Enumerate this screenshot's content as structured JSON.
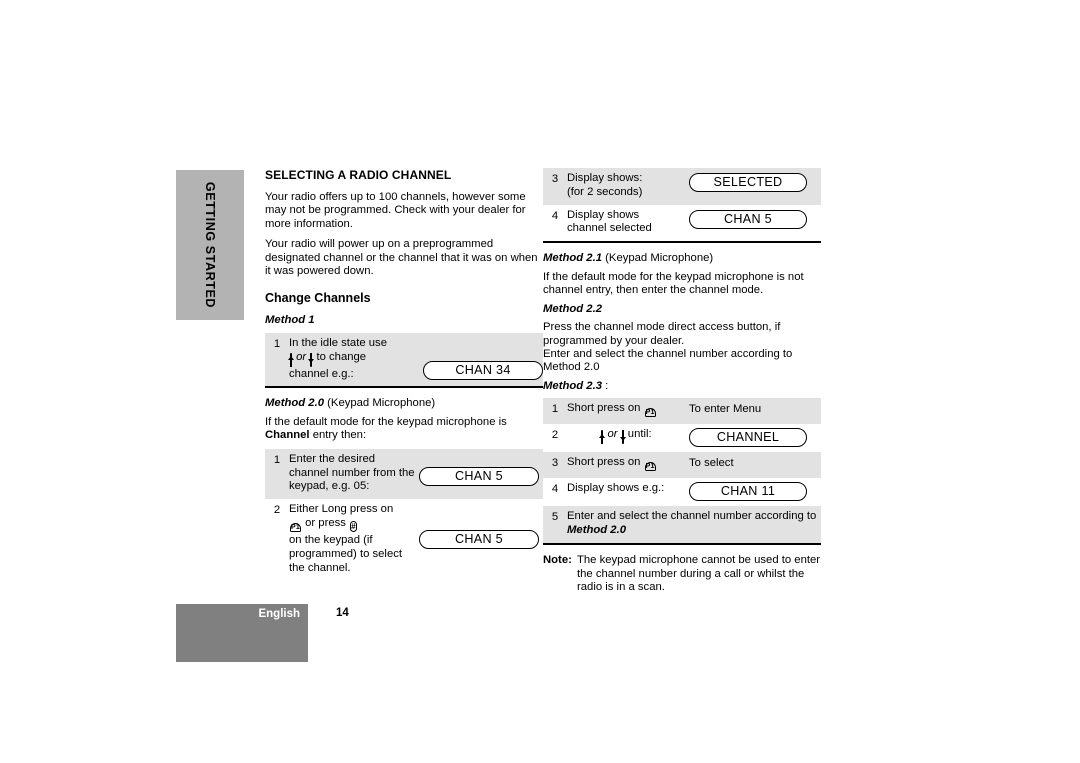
{
  "side_tab": {
    "label": "GETTING STARTED"
  },
  "footer": {
    "language": "English",
    "page_number": "14"
  },
  "left_column": {
    "section_title": "SELECTING A RADIO CHANNEL",
    "paragraphs": [
      "Your radio offers up to 100 channels, however some may not be programmed. Check with your dealer for more information.",
      "Your radio will power up on a preprogrammed designated channel or the channel that it was on when it was powered down."
    ],
    "sub_title": "Change Channels",
    "method1": {
      "heading": "Method 1",
      "steps": [
        {
          "num": "1",
          "line1": "In the idle state use",
          "or_word": "or",
          "line2_tail": "to change",
          "line3": "channel e.g.:",
          "display": "CHAN 34"
        }
      ]
    },
    "method20": {
      "heading": "Method 2.0",
      "heading_suffix": "(Keypad Microphone)",
      "lead_in_part1": "If the default mode for the keypad microphone is ",
      "lead_in_bold": "Channel",
      "lead_in_part2": " entry then:",
      "steps": [
        {
          "num": "1",
          "text": "Enter the desired channel number from the keypad, e.g. 05:",
          "display": "CHAN  5"
        },
        {
          "num": "2",
          "text_a": "Either Long press on",
          "text_b": "or press",
          "text_c": "on the keypad (if programmed) to select the channel.",
          "display": "CHAN  5"
        }
      ]
    }
  },
  "right_column": {
    "continued_steps": [
      {
        "num": "3",
        "line1": "Display shows:",
        "line2": "(for 2 seconds)",
        "display": "SELECTED"
      },
      {
        "num": "4",
        "line1": "Display shows",
        "line2": "channel selected",
        "display": "CHAN  5"
      }
    ],
    "method21": {
      "heading": "Method 2.1",
      "heading_suffix": "(Keypad Microphone)",
      "body": "If the default mode for the keypad microphone is not channel entry, then enter the channel mode."
    },
    "method22": {
      "heading": "Method 2.2",
      "body": "Press the channel mode direct access button, if programmed by your dealer.\nEnter and select the channel number according to Method 2.0"
    },
    "method23": {
      "heading": "Method 2.3",
      "heading_suffix": ":",
      "steps": [
        {
          "num": "1",
          "text": "Short press on",
          "result": "To enter Menu"
        },
        {
          "num": "2",
          "or_word": "or",
          "tail": "until:",
          "display": "CHANNEL"
        },
        {
          "num": "3",
          "text": "Short press on",
          "result": "To select"
        },
        {
          "num": "4",
          "text": "Display shows e.g.:",
          "display": "CHAN  11"
        },
        {
          "num": "5",
          "text_a": "Enter and select the channel number according to ",
          "text_b": "Method 2.0"
        }
      ]
    },
    "note": {
      "label": "Note:",
      "body": "The keypad microphone cannot be used to enter the channel number during a call or whilst the radio is in a  scan."
    }
  },
  "icons": {
    "up_key": "arrow-up-key-icon",
    "down_key": "arrow-down-key-icon",
    "p1_key": "p1-key-icon",
    "p1_label": "P1",
    "hash_key": "hash-key-icon",
    "hash_label": "#"
  },
  "colors": {
    "side_tab": "#b3b3b3",
    "footer_bar": "#808080",
    "row_shade": "#e2e2e2",
    "rule": "#000000"
  }
}
